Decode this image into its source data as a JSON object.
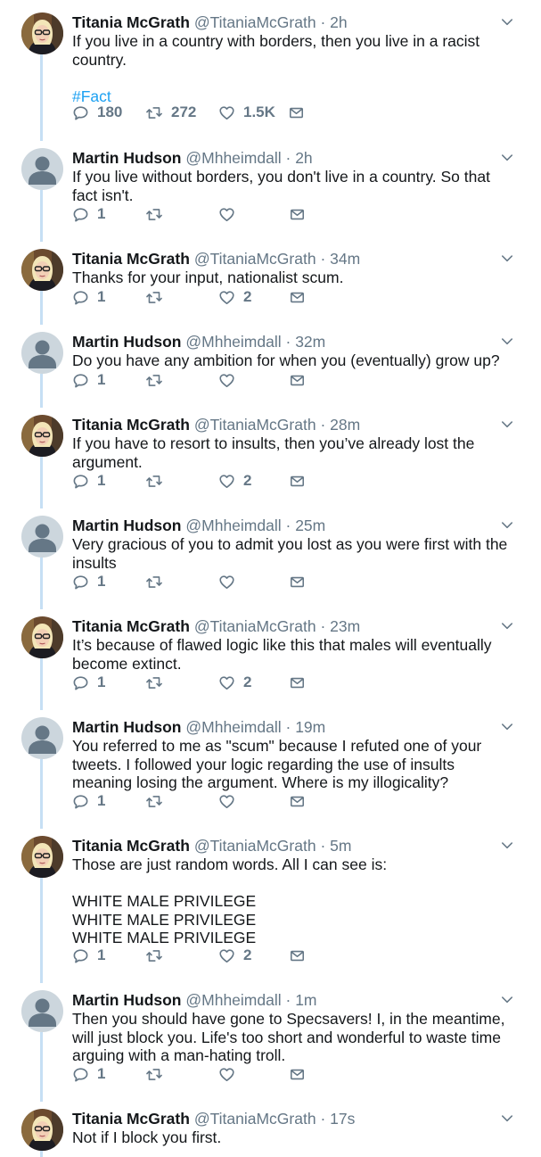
{
  "colors": {
    "thread_line": "#c6dff4",
    "link": "#1da1f2",
    "meta": "#657786",
    "text": "#14171a"
  },
  "tweets": [
    {
      "name": "Titania McGrath",
      "handle": "@TitaniaMcGrath",
      "dot": "·",
      "time": "2h",
      "text": "If you live in a country with borders, then you live in a racist country.",
      "hashtag": "#Fact",
      "replies": "180",
      "retweets": "272",
      "likes": "1.5K",
      "avatar": "titania"
    },
    {
      "name": "Martin Hudson",
      "handle": "@Mhheimdall",
      "dot": "·",
      "time": "2h",
      "text": "If you live without borders, you don't live in a country. So that fact isn't.",
      "replies": "1",
      "retweets": "",
      "likes": "",
      "avatar": "default"
    },
    {
      "name": "Titania McGrath",
      "handle": "@TitaniaMcGrath",
      "dot": "·",
      "time": "34m",
      "text": "Thanks for your input, nationalist scum.",
      "replies": "1",
      "retweets": "",
      "likes": "2",
      "avatar": "titania"
    },
    {
      "name": "Martin Hudson",
      "handle": "@Mhheimdall",
      "dot": "·",
      "time": "32m",
      "text": "Do you have any ambition for when you (eventually) grow up?",
      "replies": "1",
      "retweets": "",
      "likes": "",
      "avatar": "default"
    },
    {
      "name": "Titania McGrath",
      "handle": "@TitaniaMcGrath",
      "dot": "·",
      "time": "28m",
      "text": "If you have to resort to insults, then you’ve already lost the argument.",
      "replies": "1",
      "retweets": "",
      "likes": "2",
      "avatar": "titania"
    },
    {
      "name": "Martin Hudson",
      "handle": "@Mhheimdall",
      "dot": "·",
      "time": "25m",
      "text": "Very gracious of you to admit you lost as you were first with the insults",
      "replies": "1",
      "retweets": "",
      "likes": "",
      "avatar": "default"
    },
    {
      "name": "Titania McGrath",
      "handle": "@TitaniaMcGrath",
      "dot": "·",
      "time": "23m",
      "text": "It’s because of flawed logic like this that males will eventually become extinct.",
      "replies": "1",
      "retweets": "",
      "likes": "2",
      "avatar": "titania"
    },
    {
      "name": "Martin Hudson",
      "handle": "@Mhheimdall",
      "dot": "·",
      "time": "19m",
      "text": "You referred to me as \"scum\" because I refuted one of your tweets. I followed your logic regarding the use of insults meaning losing the argument. Where is my illogicality?",
      "replies": "1",
      "retweets": "",
      "likes": "",
      "avatar": "default"
    },
    {
      "name": "Titania McGrath",
      "handle": "@TitaniaMcGrath",
      "dot": "·",
      "time": "5m",
      "text": "Those are just random words. All I can see is:\n\nWHITE MALE PRIVILEGE\nWHITE MALE PRIVILEGE\nWHITE MALE PRIVILEGE",
      "replies": "1",
      "retweets": "",
      "likes": "2",
      "avatar": "titania"
    },
    {
      "name": "Martin Hudson",
      "handle": "@Mhheimdall",
      "dot": "·",
      "time": "1m",
      "text": "Then you should have gone to Specsavers! I, in the meantime, will just block you. Life's too short and wonderful to waste time arguing with a man-hating troll.",
      "replies": "1",
      "retweets": "",
      "likes": "",
      "avatar": "default"
    },
    {
      "name": "Titania McGrath",
      "handle": "@TitaniaMcGrath",
      "dot": "·",
      "time": "17s",
      "text": "Not if I block you first.",
      "avatar": "titania"
    }
  ]
}
